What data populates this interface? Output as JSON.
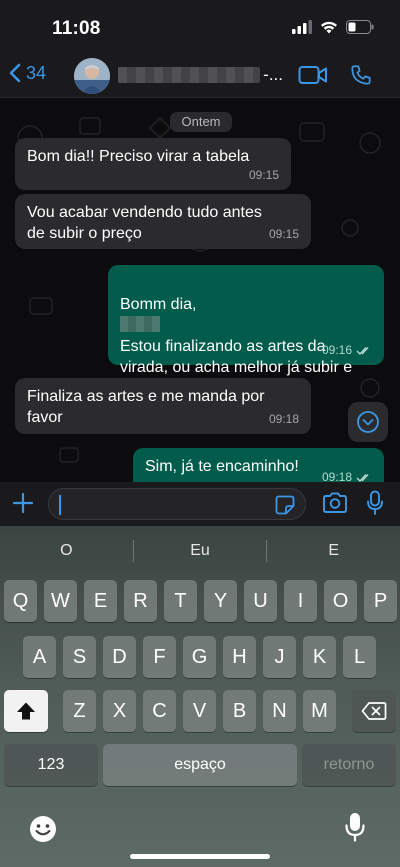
{
  "status_bar": {
    "time": "11:08"
  },
  "header": {
    "back_count": "34",
    "contact_suffix": "-..."
  },
  "chat": {
    "date_label": "Ontem",
    "messages": [
      {
        "direction": "in",
        "text": "Bom dia!! Preciso virar a tabela",
        "time": "09:15"
      },
      {
        "direction": "in",
        "text": "Vou acabar vendendo tudo antes\nde subir o preço",
        "time": "09:15"
      },
      {
        "direction": "out",
        "greeting": "Bomm dia,",
        "text": "Estou finalizando as artes da\nvirada, ou acha melhor já subir e\nanunciar o novo preço?",
        "time": "09:16",
        "status": "read"
      },
      {
        "direction": "in",
        "text": "Finaliza as artes e me manda por\nfavor",
        "time": "09:18"
      },
      {
        "direction": "out",
        "text": "Sim, já te encaminho!",
        "time": "09:18",
        "status": "read"
      }
    ]
  },
  "input": {
    "value": "",
    "placeholder": ""
  },
  "keyboard": {
    "suggestions": [
      "O",
      "Eu",
      "E"
    ],
    "row1": [
      "Q",
      "W",
      "E",
      "R",
      "T",
      "Y",
      "U",
      "I",
      "O",
      "P"
    ],
    "row2": [
      "A",
      "S",
      "D",
      "F",
      "G",
      "H",
      "J",
      "K",
      "L"
    ],
    "row3": [
      "Z",
      "X",
      "C",
      "V",
      "B",
      "N",
      "M"
    ],
    "numbers_label": "123",
    "space_label": "espaço",
    "return_label": "retorno"
  },
  "colors": {
    "accent": "#3b97e6",
    "outgoing_bubble": "#015c4b",
    "incoming_bubble": "#2b2b2e"
  },
  "icons": {
    "back": "chevron-left-icon",
    "video": "video-camera-icon",
    "call": "phone-icon",
    "plus": "plus-icon",
    "sticker": "sticker-icon",
    "camera": "camera-icon",
    "mic": "microphone-icon",
    "scroll_down": "chevron-down-circle-icon",
    "shift": "shift-icon",
    "delete": "backspace-icon",
    "emoji": "emoji-icon",
    "dictation": "microphone-icon"
  }
}
